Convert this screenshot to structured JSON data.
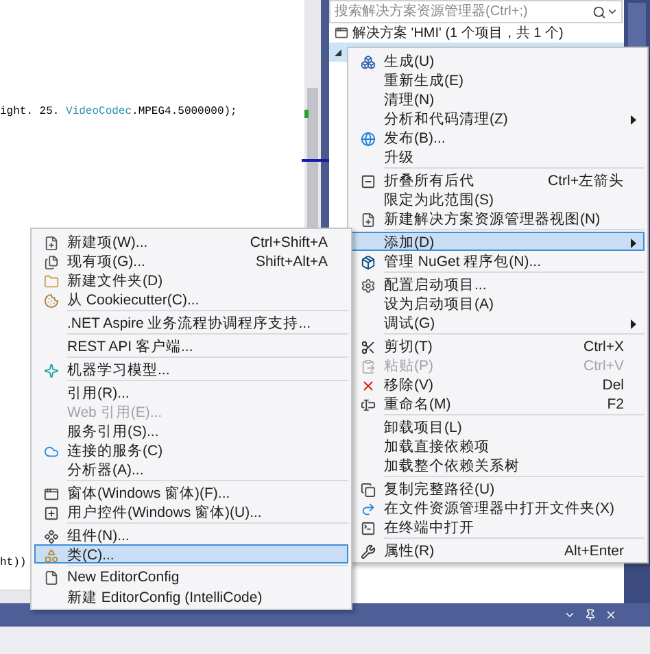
{
  "editor": {
    "lines": [
      {
        "segments": [
          {
            "text": "ight. 25. ",
            "kind": "plain"
          },
          {
            "text": "VideoCodec",
            "kind": "type"
          },
          {
            "text": ".MPEG4.5000000);",
            "kind": "plain"
          }
        ]
      },
      {
        "segments": [
          {
            "text": "ht))",
            "kind": "plain"
          }
        ]
      }
    ]
  },
  "solution_explorer": {
    "search": {
      "placeholder": "搜索解决方案资源管理器(Ctrl+;)"
    },
    "solution": "解决方案 'HMI' (1 个项目，共 1 个)",
    "project": {
      "expanded": true,
      "selected": true
    }
  },
  "context_menu": {
    "items": [
      {
        "kind": "item",
        "label": "生成(U)",
        "has_submenu": false,
        "disabled": false,
        "selected": false
      },
      {
        "kind": "item",
        "label": "重新生成(E)",
        "has_submenu": false,
        "disabled": false,
        "selected": false
      },
      {
        "kind": "item",
        "label": "清理(N)",
        "has_submenu": false,
        "disabled": false,
        "selected": false
      },
      {
        "kind": "item",
        "label": "分析和代码清理(Z)",
        "has_submenu": true,
        "disabled": false,
        "selected": false
      },
      {
        "kind": "item",
        "label": "发布(B)...",
        "has_submenu": false,
        "disabled": false,
        "selected": false
      },
      {
        "kind": "item",
        "label": "升级",
        "has_submenu": false,
        "disabled": false,
        "selected": false
      },
      {
        "kind": "separator"
      },
      {
        "kind": "item",
        "label": "折叠所有后代",
        "shortcut": "Ctrl+左箭头",
        "has_submenu": false,
        "disabled": false,
        "selected": false
      },
      {
        "kind": "item",
        "label": "限定为此范围(S)",
        "has_submenu": false,
        "disabled": false,
        "selected": false
      },
      {
        "kind": "item",
        "label": "新建解决方案资源管理器视图(N)",
        "has_submenu": false,
        "disabled": false,
        "selected": false
      },
      {
        "kind": "separator"
      },
      {
        "kind": "item",
        "label": "添加(D)",
        "has_submenu": true,
        "disabled": false,
        "selected": true
      },
      {
        "kind": "item",
        "label": "管理 NuGet 程序包(N)...",
        "has_submenu": false,
        "disabled": false,
        "selected": false
      },
      {
        "kind": "separator"
      },
      {
        "kind": "item",
        "label": "配置启动项目...",
        "has_submenu": false,
        "disabled": false,
        "selected": false
      },
      {
        "kind": "item",
        "label": "设为启动项目(A)",
        "has_submenu": false,
        "disabled": false,
        "selected": false
      },
      {
        "kind": "item",
        "label": "调试(G)",
        "has_submenu": true,
        "disabled": false,
        "selected": false
      },
      {
        "kind": "separator"
      },
      {
        "kind": "item",
        "label": "剪切(T)",
        "shortcut": "Ctrl+X",
        "has_submenu": false,
        "disabled": false,
        "selected": false
      },
      {
        "kind": "item",
        "label": "粘贴(P)",
        "shortcut": "Ctrl+V",
        "has_submenu": false,
        "disabled": true,
        "selected": false
      },
      {
        "kind": "item",
        "label": "移除(V)",
        "shortcut": "Del",
        "has_submenu": false,
        "disabled": false,
        "selected": false
      },
      {
        "kind": "item",
        "label": "重命名(M)",
        "shortcut": "F2",
        "has_submenu": false,
        "disabled": false,
        "selected": false
      },
      {
        "kind": "separator"
      },
      {
        "kind": "item",
        "label": "卸载项目(L)",
        "has_submenu": false,
        "disabled": false,
        "selected": false
      },
      {
        "kind": "item",
        "label": "加载直接依赖项",
        "has_submenu": false,
        "disabled": false,
        "selected": false
      },
      {
        "kind": "item",
        "label": "加载整个依赖关系树",
        "has_submenu": false,
        "disabled": false,
        "selected": false
      },
      {
        "kind": "separator"
      },
      {
        "kind": "item",
        "label": "复制完整路径(U)",
        "has_submenu": false,
        "disabled": false,
        "selected": false
      },
      {
        "kind": "item",
        "label": "在文件资源管理器中打开文件夹(X)",
        "has_submenu": false,
        "disabled": false,
        "selected": false
      },
      {
        "kind": "item",
        "label": "在终端中打开",
        "has_submenu": false,
        "disabled": false,
        "selected": false
      },
      {
        "kind": "separator"
      },
      {
        "kind": "item",
        "label": "属性(R)",
        "shortcut": "Alt+Enter",
        "has_submenu": false,
        "disabled": false,
        "selected": false
      }
    ]
  },
  "add_submenu": {
    "items": [
      {
        "kind": "item",
        "label": "新建项(W)...",
        "shortcut": "Ctrl+Shift+A",
        "has_submenu": false,
        "disabled": false,
        "selected": false
      },
      {
        "kind": "item",
        "label": "现有项(G)...",
        "shortcut": "Shift+Alt+A",
        "has_submenu": false,
        "disabled": false,
        "selected": false
      },
      {
        "kind": "item",
        "label": "新建文件夹(D)",
        "has_submenu": false,
        "disabled": false,
        "selected": false
      },
      {
        "kind": "item",
        "label": "从 Cookiecutter(C)...",
        "has_submenu": false,
        "disabled": false,
        "selected": false
      },
      {
        "kind": "separator"
      },
      {
        "kind": "item",
        "label": ".NET Aspire 业务流程协调程序支持...",
        "has_submenu": false,
        "disabled": false,
        "selected": false
      },
      {
        "kind": "separator"
      },
      {
        "kind": "item",
        "label": "REST API 客户端...",
        "has_submenu": false,
        "disabled": false,
        "selected": false
      },
      {
        "kind": "separator"
      },
      {
        "kind": "item",
        "label": "机器学习模型...",
        "has_submenu": false,
        "disabled": false,
        "selected": false
      },
      {
        "kind": "separator"
      },
      {
        "kind": "item",
        "label": "引用(R)...",
        "has_submenu": false,
        "disabled": false,
        "selected": false
      },
      {
        "kind": "item",
        "label": "Web 引用(E)...",
        "has_submenu": false,
        "disabled": true,
        "selected": false
      },
      {
        "kind": "item",
        "label": "服务引用(S)...",
        "has_submenu": false,
        "disabled": false,
        "selected": false
      },
      {
        "kind": "item",
        "label": "连接的服务(C)",
        "has_submenu": false,
        "disabled": false,
        "selected": false
      },
      {
        "kind": "item",
        "label": "分析器(A)...",
        "has_submenu": false,
        "disabled": false,
        "selected": false
      },
      {
        "kind": "separator"
      },
      {
        "kind": "item",
        "label": "窗体(Windows 窗体)(F)...",
        "has_submenu": false,
        "disabled": false,
        "selected": false
      },
      {
        "kind": "item",
        "label": "用户控件(Windows 窗体)(U)...",
        "has_submenu": false,
        "disabled": false,
        "selected": false
      },
      {
        "kind": "separator"
      },
      {
        "kind": "item",
        "label": "组件(N)...",
        "has_submenu": false,
        "disabled": false,
        "selected": false
      },
      {
        "kind": "item",
        "label": "类(C)...",
        "has_submenu": false,
        "disabled": false,
        "selected": true
      },
      {
        "kind": "separator"
      },
      {
        "kind": "item",
        "label": "New EditorConfig",
        "has_submenu": false,
        "disabled": false,
        "selected": false
      },
      {
        "kind": "item",
        "label": "新建 EditorConfig (IntelliCode)",
        "has_submenu": false,
        "disabled": false,
        "selected": false
      }
    ]
  }
}
